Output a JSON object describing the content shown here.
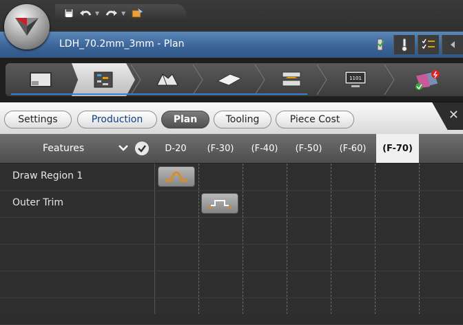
{
  "window": {
    "document_title": "LDH_70.2mm_3mm - Plan"
  },
  "quick_access": {
    "icons": [
      "save-icon",
      "undo-icon",
      "redo-icon",
      "customize-icon"
    ]
  },
  "doc_tools": {
    "icons": [
      "check-flag-icon",
      "thermometer-icon",
      "checklist-icon",
      "collapse-left-icon"
    ]
  },
  "stages": {
    "items": [
      {
        "icon": "part-icon"
      },
      {
        "icon": "process-plan-icon",
        "active": true
      },
      {
        "icon": "die-face-icon"
      },
      {
        "icon": "blank-icon"
      },
      {
        "icon": "tooling-icon"
      },
      {
        "icon": "monitor-1101-icon",
        "text": "1101"
      },
      {
        "icon": "formability-result-icon"
      }
    ]
  },
  "tabs": {
    "items": [
      {
        "label": "Settings"
      },
      {
        "label": "Production"
      },
      {
        "label": "Plan"
      },
      {
        "label": "Tooling"
      },
      {
        "label": "Piece Cost"
      }
    ],
    "active_index": 2,
    "close_label": "✕"
  },
  "grid": {
    "features_label": "Features",
    "columns": [
      "D-20",
      "(F-30)",
      "(F-40)",
      "(F-50)",
      "(F-60)",
      "(F-70)"
    ],
    "current_column_index": 5,
    "rows": [
      {
        "label": "Draw Region 1",
        "op_column": 0,
        "op_icon": "draw-op-icon"
      },
      {
        "label": "Outer Trim",
        "op_column": 1,
        "op_icon": "trim-op-icon"
      },
      {
        "label": ""
      },
      {
        "label": ""
      },
      {
        "label": ""
      },
      {
        "label": ""
      }
    ]
  },
  "colors": {
    "accent_blue": "#3b7fd4",
    "draw_op_orange": "#e08a1e",
    "title_strip": "#3a6497"
  }
}
